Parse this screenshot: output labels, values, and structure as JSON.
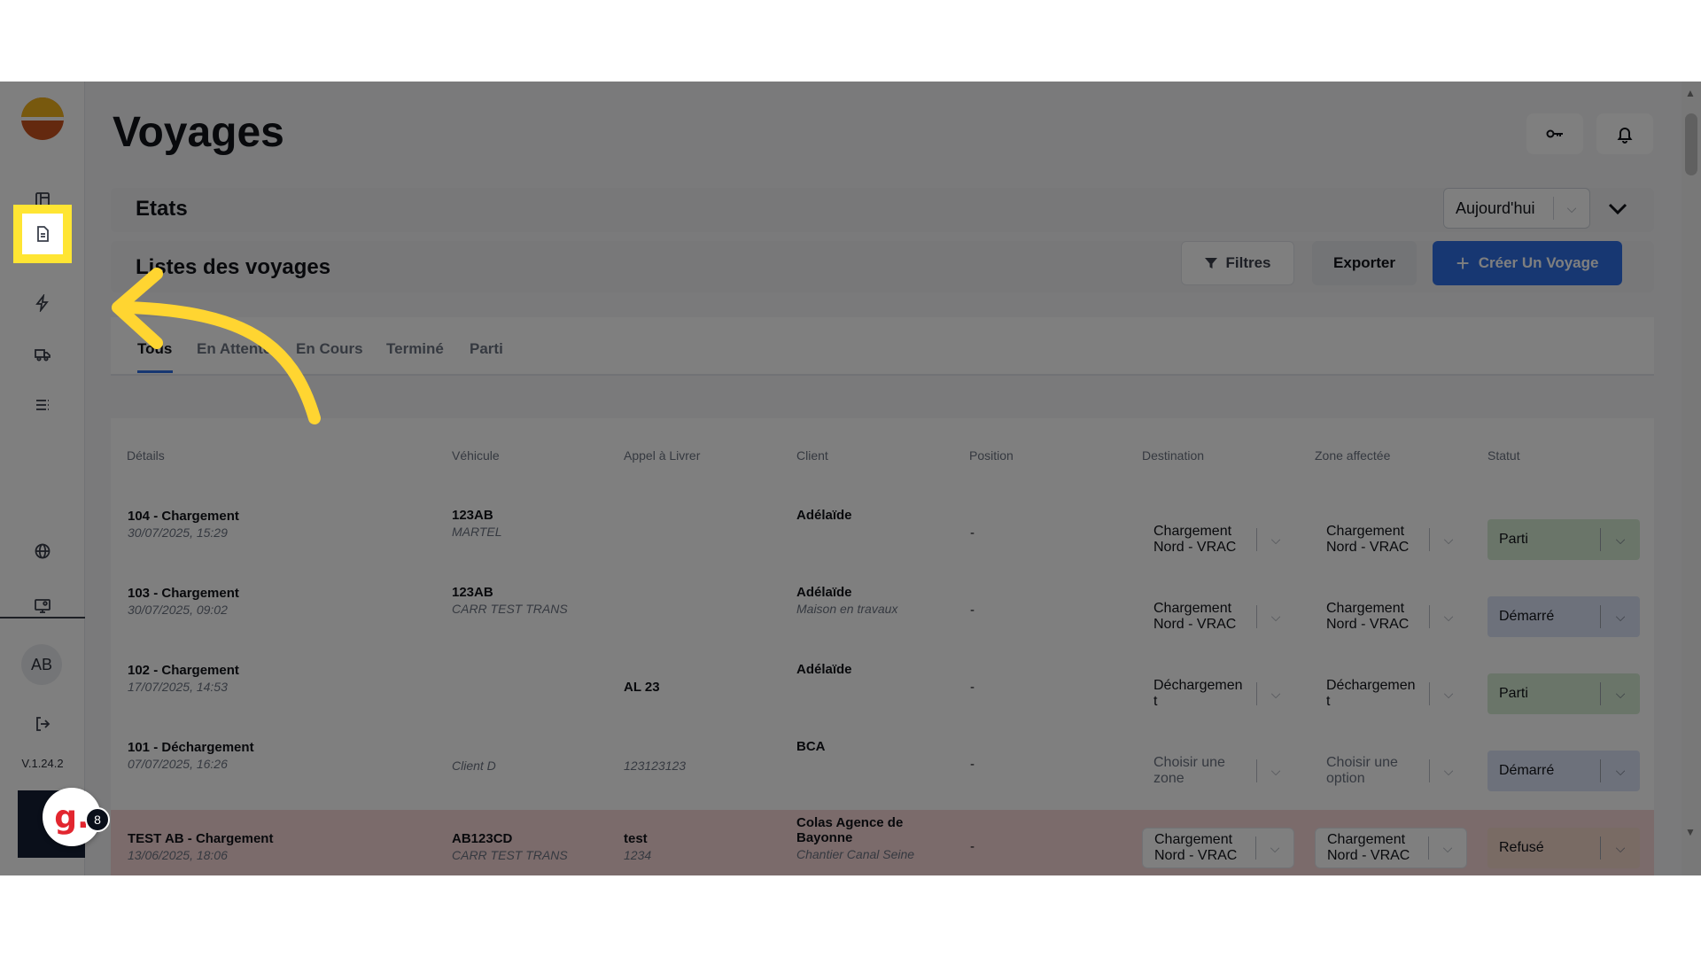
{
  "page": {
    "title": "Voyages"
  },
  "app": {
    "version": "V.1.24.2",
    "user_initials": "AB"
  },
  "sidebar": {
    "items": [
      {
        "name": "dashboard",
        "icon": "layout-icon"
      },
      {
        "name": "voyages",
        "icon": "document-icon"
      },
      {
        "name": "activity",
        "icon": "lightning-icon"
      },
      {
        "name": "vehicles",
        "icon": "truck-icon"
      },
      {
        "name": "lists",
        "icon": "list-icon"
      },
      {
        "name": "globe",
        "icon": "globe-icon"
      },
      {
        "name": "screen",
        "icon": "monitor-icon"
      },
      {
        "name": "logout",
        "icon": "logout-icon"
      }
    ]
  },
  "stats": {
    "title": "Etats",
    "period": "Aujourd'hui"
  },
  "list": {
    "title": "Listes des voyages",
    "filter_label": "Filtres",
    "export_label": "Exporter",
    "create_label": "Créer Un Voyage"
  },
  "tabs": [
    {
      "label": "Tous",
      "active": true
    },
    {
      "label": "En Attente"
    },
    {
      "label": "En Cours"
    },
    {
      "label": "Terminé"
    },
    {
      "label": "Parti"
    }
  ],
  "table": {
    "headers": [
      "Détails",
      "Véhicule",
      "Appel à Livrer",
      "Client",
      "Position",
      "Destination",
      "Zone affectée",
      "Statut"
    ],
    "rows": [
      {
        "title": "104 - Chargement",
        "date": "30/07/2025, 15:29",
        "vehicle": "123AB",
        "carrier": "MARTEL",
        "call": "",
        "call_sub": "",
        "client": "Adélaïde",
        "client_sub": "",
        "position": "-",
        "dest1": "Chargement",
        "dest2": "Nord - VRAC",
        "zone1": "Chargement",
        "zone2": "Nord - VRAC",
        "status": "Parti"
      },
      {
        "title": "103 - Chargement",
        "date": "30/07/2025, 09:02",
        "vehicle": "123AB",
        "carrier": "CARR TEST TRANS",
        "call": "",
        "call_sub": "",
        "client": "Adélaïde",
        "client_sub": "Maison en travaux",
        "position": "-",
        "dest1": "Chargement",
        "dest2": "Nord - VRAC",
        "zone1": "Chargement",
        "zone2": "Nord - VRAC",
        "status": "Démarré"
      },
      {
        "title": "102 - Chargement",
        "date": "17/07/2025, 14:53",
        "vehicle": "",
        "carrier": "",
        "call": "AL 23",
        "call_sub": "",
        "client": "Adélaïde",
        "client_sub": "",
        "position": "-",
        "dest1": "Déchargemen",
        "dest2": "t",
        "zone1": "Déchargemen",
        "zone2": "t",
        "status": "Parti"
      },
      {
        "title": "101 - Déchargement",
        "date": "07/07/2025, 16:26",
        "vehicle": "",
        "carrier": "Client D",
        "call": "",
        "call_sub": "123123123",
        "client": "BCA",
        "client_sub": "",
        "position": "-",
        "dest1": "Choisir une",
        "dest2": "zone",
        "zone1": "Choisir une",
        "zone2": "option",
        "status": "Démarré"
      },
      {
        "title": "TEST AB - Chargement",
        "date": "13/06/2025, 18:06",
        "vehicle": "AB123CD",
        "carrier": "CARR TEST TRANS",
        "call": "test",
        "call_sub": "1234",
        "client": "Colas Agence de Bayonne",
        "client_sub": "Chantier Canal Seine",
        "position": "-",
        "dest1": "Chargement",
        "dest2": "Nord - VRAC",
        "zone1": "Chargement",
        "zone2": "Nord - VRAC",
        "status": "Refusé"
      }
    ]
  },
  "widget": {
    "letter": "g.",
    "badge": "8"
  },
  "colors": {
    "primary": "#2f6fe4",
    "highlight": "#ffe533",
    "parti": "#d5ead3",
    "demarre": "#dbe3f7",
    "refuse": "#f2d6c8"
  }
}
